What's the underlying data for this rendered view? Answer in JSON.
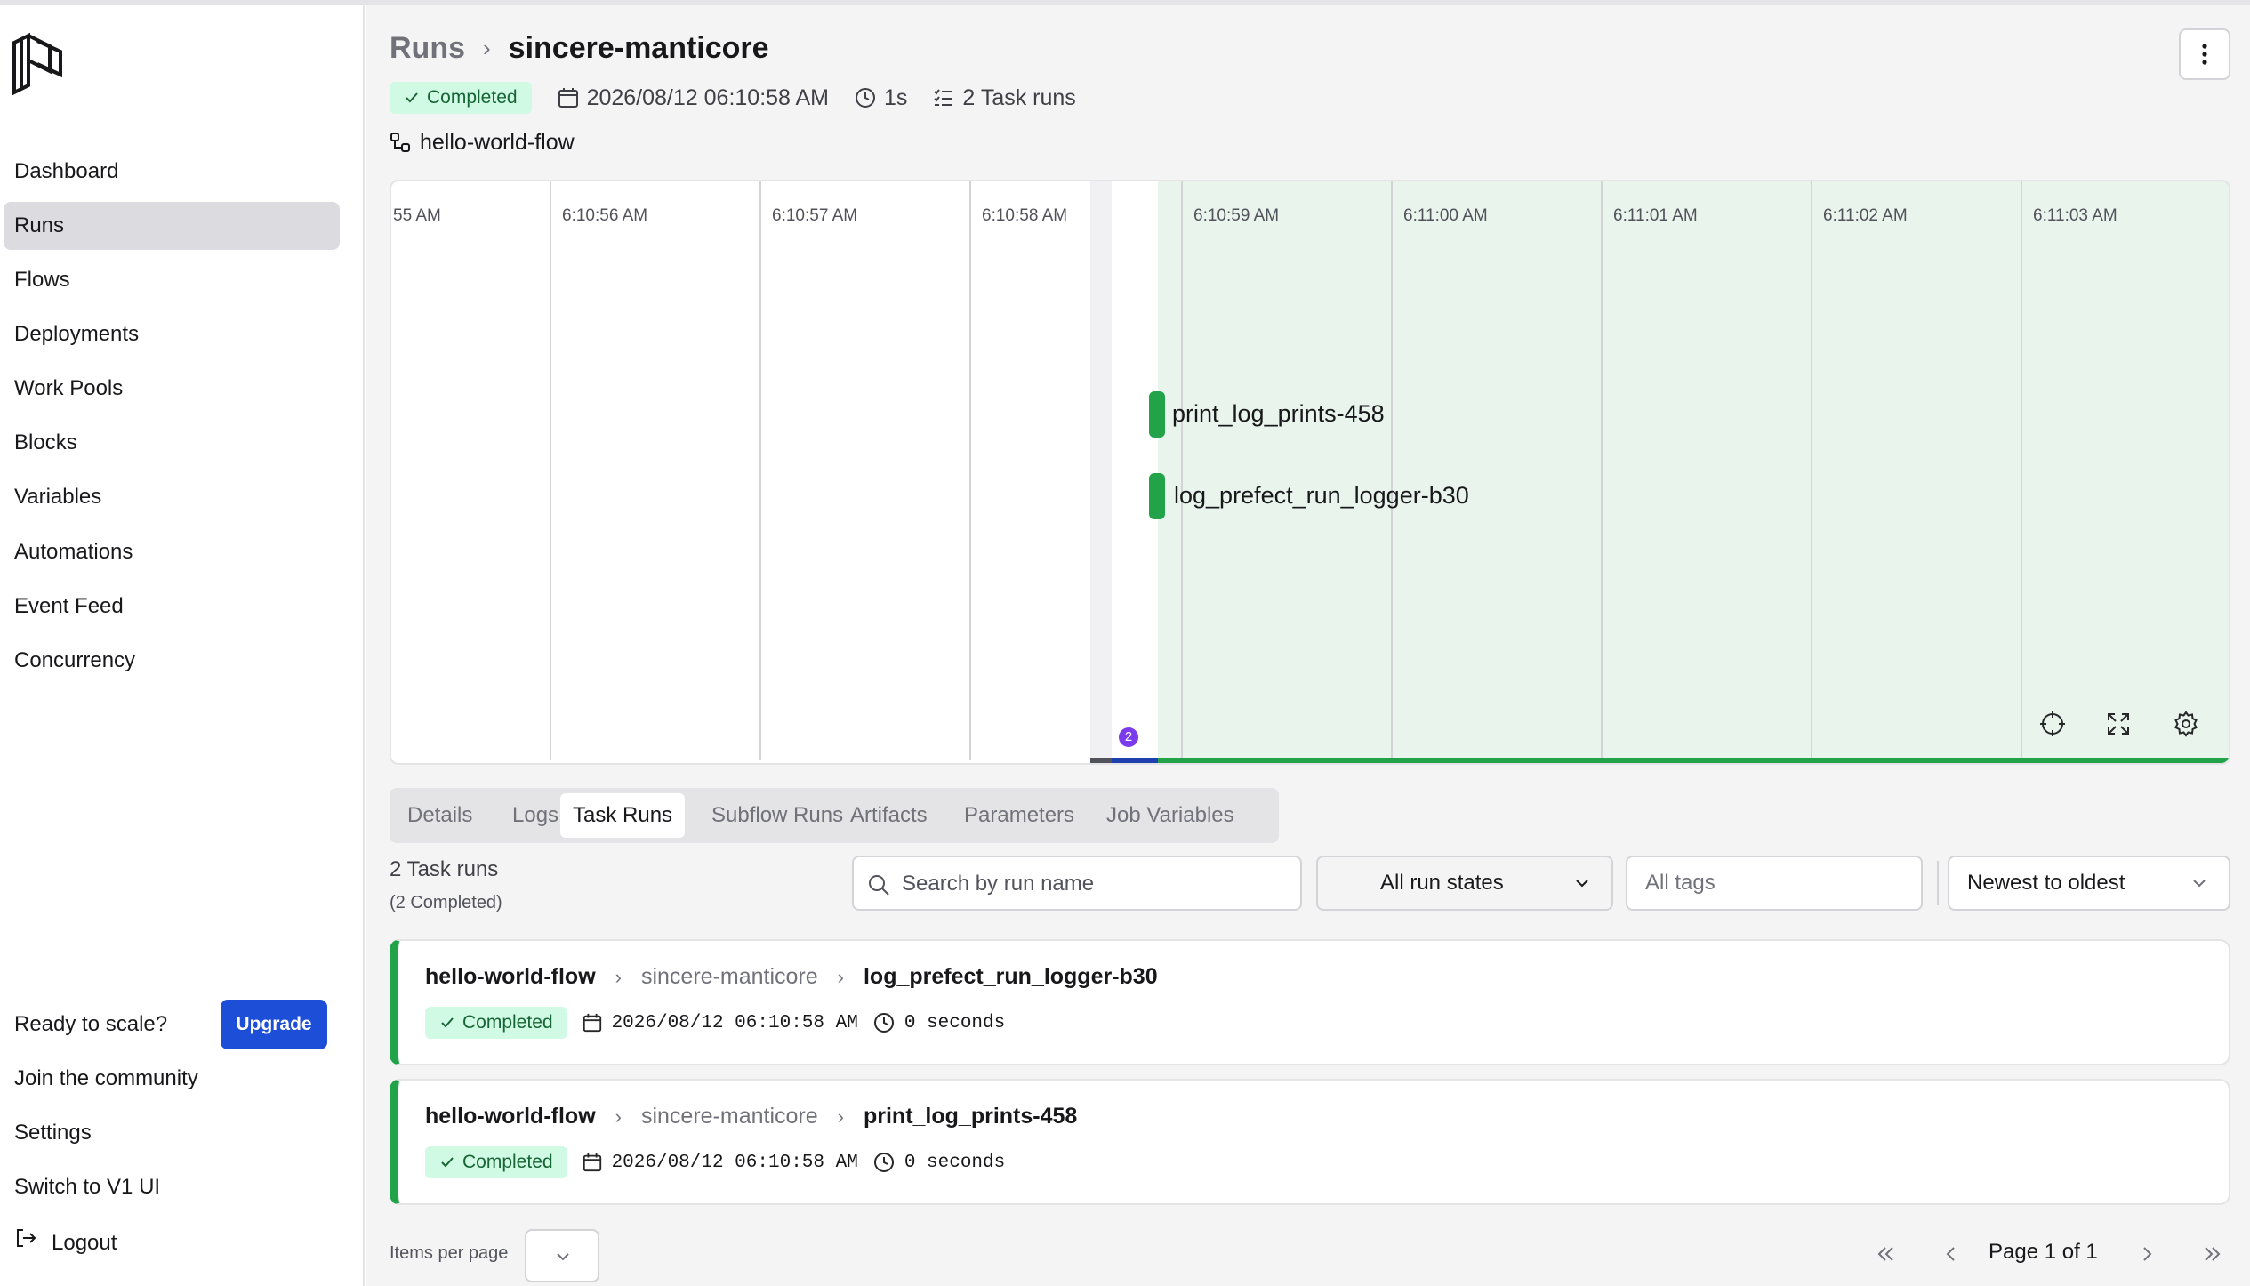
{
  "sidebar": {
    "logo_icon": "prefect-logo-icon",
    "items": [
      {
        "label": "Dashboard"
      },
      {
        "label": "Runs",
        "active": true
      },
      {
        "label": "Flows"
      },
      {
        "label": "Deployments"
      },
      {
        "label": "Work Pools"
      },
      {
        "label": "Blocks"
      },
      {
        "label": "Variables"
      },
      {
        "label": "Automations"
      },
      {
        "label": "Event Feed"
      },
      {
        "label": "Concurrency"
      }
    ],
    "bottom": {
      "ready_label": "Ready to scale?",
      "upgrade_label": "Upgrade",
      "community_label": "Join the community",
      "settings_label": "Settings",
      "switch_label": "Switch to V1 UI",
      "logout_label": "Logout"
    }
  },
  "header": {
    "breadcrumb_root": "Runs",
    "breadcrumb_current": "sincere-manticore",
    "status": "Completed",
    "start_time": "2026/08/12 06:10:58 AM",
    "duration": "1s",
    "task_runs": "2 Task runs",
    "flow_name": "hello-world-flow"
  },
  "timeline": {
    "tick_labels": [
      "55 AM",
      "6:10:56 AM",
      "6:10:57 AM",
      "6:10:58 AM",
      "6:10:59 AM",
      "6:11:00 AM",
      "6:11:01 AM",
      "6:11:02 AM",
      "6:11:03 AM"
    ],
    "tasks": [
      {
        "name": "print_log_prints-458"
      },
      {
        "name": "log_prefect_run_logger-b30"
      }
    ],
    "event_count": "2",
    "colors": {
      "completed": "#22a34a",
      "running_band": "#e8f4ec",
      "pending": "#1e40af"
    }
  },
  "tabs": [
    {
      "label": "Details"
    },
    {
      "label": "Logs"
    },
    {
      "label": "Task Runs",
      "active": true
    },
    {
      "label": "Subflow Runs"
    },
    {
      "label": "Artifacts"
    },
    {
      "label": "Parameters"
    },
    {
      "label": "Job Variables"
    }
  ],
  "task_runs": {
    "count_title": "2 Task runs",
    "count_sub": "(2 Completed)",
    "search_placeholder": "Search by run name",
    "states_value": "All run states",
    "tags_placeholder": "All tags",
    "sort_value": "Newest to oldest",
    "items": [
      {
        "flow": "hello-world-flow",
        "run": "sincere-manticore",
        "task": "log_prefect_run_logger-b30",
        "status": "Completed",
        "time": "2026/08/12 06:10:58 AM",
        "duration": "0 seconds"
      },
      {
        "flow": "hello-world-flow",
        "run": "sincere-manticore",
        "task": "print_log_prints-458",
        "status": "Completed",
        "time": "2026/08/12 06:10:58 AM",
        "duration": "0 seconds"
      }
    ]
  },
  "pagination": {
    "items_per_page_label": "Items per page",
    "page_text": "Page 1 of 1"
  }
}
